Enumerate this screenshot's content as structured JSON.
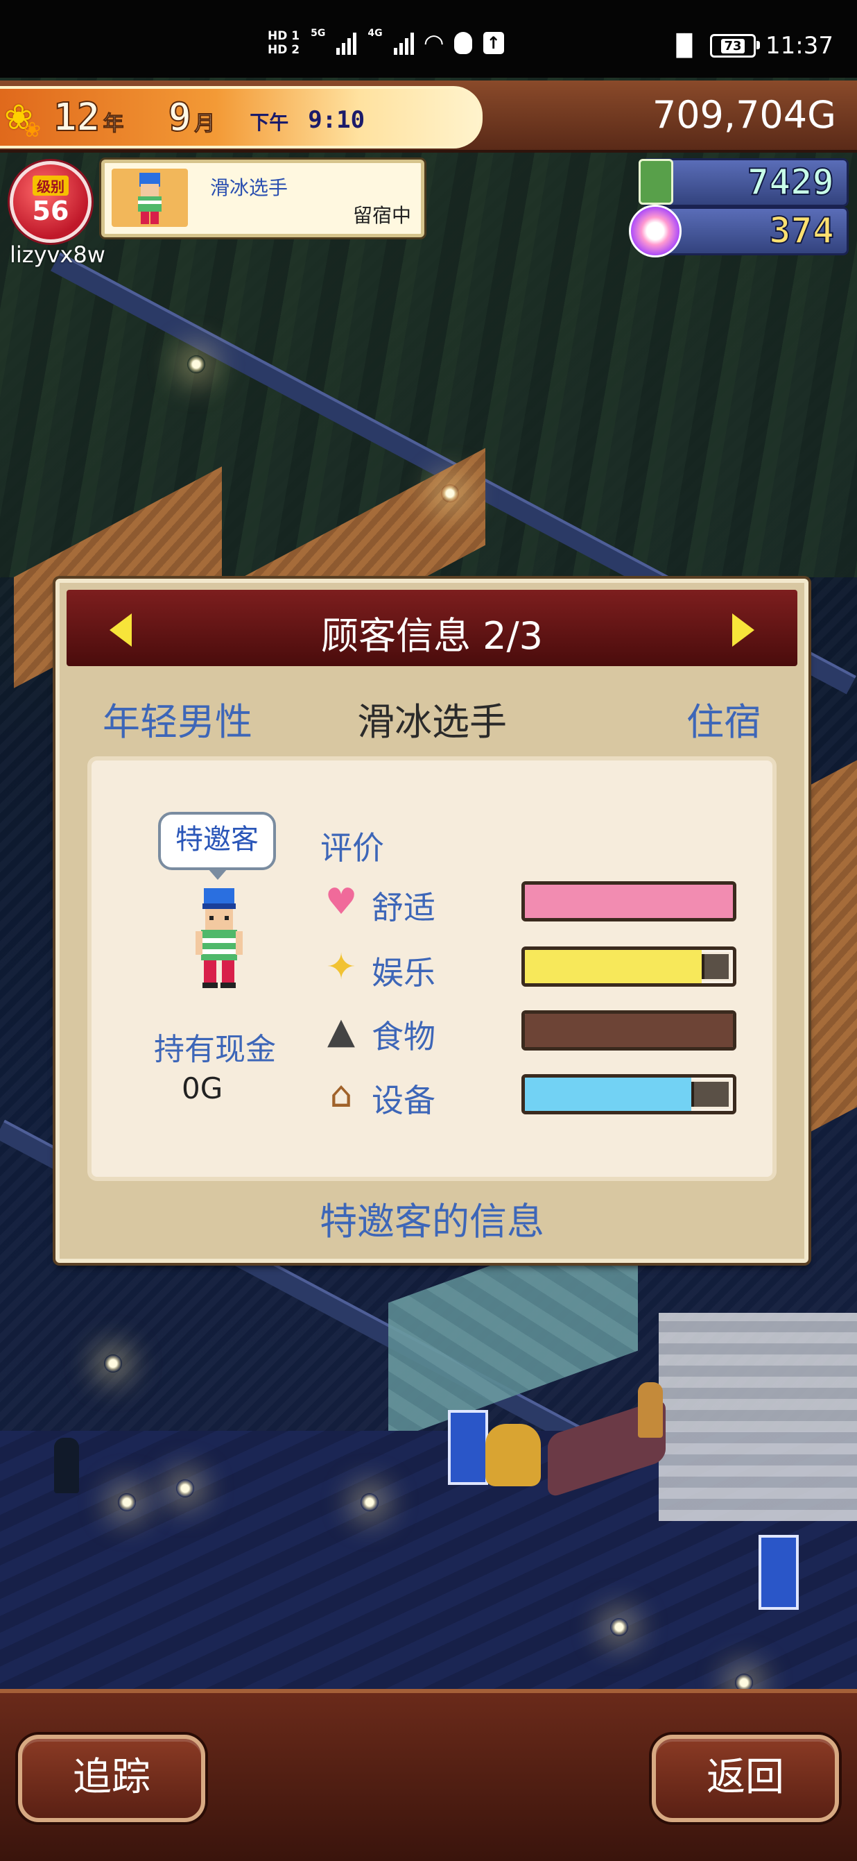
{
  "status_bar": {
    "hd1": "HD 1",
    "hd2": "HD 2",
    "net1": "5G",
    "net2": "4G",
    "battery": "73",
    "time": "11:37"
  },
  "hud": {
    "year_num": "12",
    "year_unit": "年",
    "month_num": "9",
    "month_unit": "月",
    "period": "下午",
    "clock": "9:10",
    "money": "709,704G",
    "level_label": "级别",
    "level": "56",
    "username": "lizyvx8w",
    "guest_name": "滑冰选手",
    "guest_status": "留宿中",
    "tickets": "7429",
    "medals": "374"
  },
  "dialog": {
    "title": "顾客信息 2/3",
    "category_type": "年轻男性",
    "category_name": "滑冰选手",
    "category_status": "住宿",
    "special_badge": "特邀客",
    "cash_label": "持有现金",
    "cash_value": "0G",
    "evaluation_label": "评价",
    "ratings": [
      {
        "label": "舒适",
        "icon": "heart-icon",
        "color": "#f28cb1",
        "value": 1.0
      },
      {
        "label": "娱乐",
        "icon": "sparkle-icon",
        "color": "#f7e85a",
        "value": 0.85
      },
      {
        "label": "食物",
        "icon": "rice-ball-icon",
        "color": "#6d4436",
        "value": 1.0
      },
      {
        "label": "设备",
        "icon": "house-icon",
        "color": "#72d2f4",
        "value": 0.8
      }
    ],
    "footer": "特邀客的信息"
  },
  "buttons": {
    "track": "追踪",
    "back": "返回"
  }
}
